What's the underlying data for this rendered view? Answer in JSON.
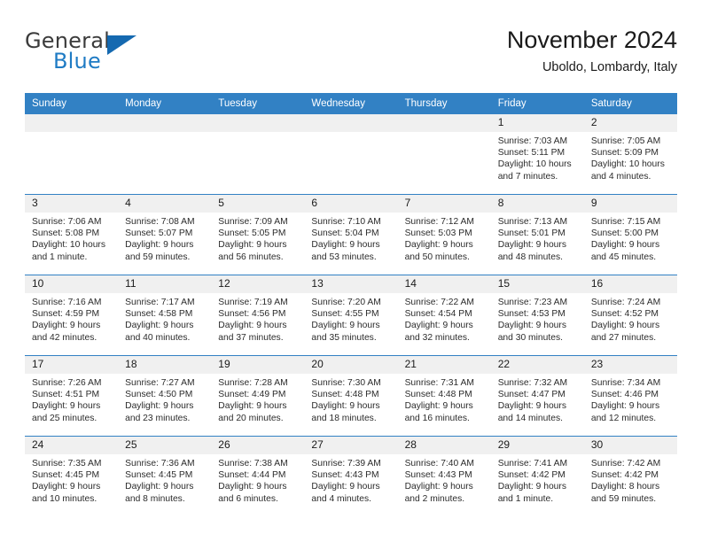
{
  "brand": {
    "word_top": "General",
    "word_bottom": "Blue",
    "triangle_color": "#1569b0",
    "blue_color": "#1f7bc4"
  },
  "header": {
    "title": "November 2024",
    "location": "Uboldo, Lombardy, Italy"
  },
  "theme": {
    "header_blue": "#3281c4",
    "daynum_bg": "#f0f0f0",
    "text": "#2b2b2b"
  },
  "weekdays": [
    "Sunday",
    "Monday",
    "Tuesday",
    "Wednesday",
    "Thursday",
    "Friday",
    "Saturday"
  ],
  "weeks": [
    [
      {
        "day": "",
        "empty": true
      },
      {
        "day": "",
        "empty": true
      },
      {
        "day": "",
        "empty": true
      },
      {
        "day": "",
        "empty": true
      },
      {
        "day": "",
        "empty": true
      },
      {
        "day": "1",
        "sunrise": "Sunrise: 7:03 AM",
        "sunset": "Sunset: 5:11 PM",
        "daylight1": "Daylight: 10 hours",
        "daylight2": "and 7 minutes."
      },
      {
        "day": "2",
        "sunrise": "Sunrise: 7:05 AM",
        "sunset": "Sunset: 5:09 PM",
        "daylight1": "Daylight: 10 hours",
        "daylight2": "and 4 minutes."
      }
    ],
    [
      {
        "day": "3",
        "sunrise": "Sunrise: 7:06 AM",
        "sunset": "Sunset: 5:08 PM",
        "daylight1": "Daylight: 10 hours",
        "daylight2": "and 1 minute."
      },
      {
        "day": "4",
        "sunrise": "Sunrise: 7:08 AM",
        "sunset": "Sunset: 5:07 PM",
        "daylight1": "Daylight: 9 hours",
        "daylight2": "and 59 minutes."
      },
      {
        "day": "5",
        "sunrise": "Sunrise: 7:09 AM",
        "sunset": "Sunset: 5:05 PM",
        "daylight1": "Daylight: 9 hours",
        "daylight2": "and 56 minutes."
      },
      {
        "day": "6",
        "sunrise": "Sunrise: 7:10 AM",
        "sunset": "Sunset: 5:04 PM",
        "daylight1": "Daylight: 9 hours",
        "daylight2": "and 53 minutes."
      },
      {
        "day": "7",
        "sunrise": "Sunrise: 7:12 AM",
        "sunset": "Sunset: 5:03 PM",
        "daylight1": "Daylight: 9 hours",
        "daylight2": "and 50 minutes."
      },
      {
        "day": "8",
        "sunrise": "Sunrise: 7:13 AM",
        "sunset": "Sunset: 5:01 PM",
        "daylight1": "Daylight: 9 hours",
        "daylight2": "and 48 minutes."
      },
      {
        "day": "9",
        "sunrise": "Sunrise: 7:15 AM",
        "sunset": "Sunset: 5:00 PM",
        "daylight1": "Daylight: 9 hours",
        "daylight2": "and 45 minutes."
      }
    ],
    [
      {
        "day": "10",
        "sunrise": "Sunrise: 7:16 AM",
        "sunset": "Sunset: 4:59 PM",
        "daylight1": "Daylight: 9 hours",
        "daylight2": "and 42 minutes."
      },
      {
        "day": "11",
        "sunrise": "Sunrise: 7:17 AM",
        "sunset": "Sunset: 4:58 PM",
        "daylight1": "Daylight: 9 hours",
        "daylight2": "and 40 minutes."
      },
      {
        "day": "12",
        "sunrise": "Sunrise: 7:19 AM",
        "sunset": "Sunset: 4:56 PM",
        "daylight1": "Daylight: 9 hours",
        "daylight2": "and 37 minutes."
      },
      {
        "day": "13",
        "sunrise": "Sunrise: 7:20 AM",
        "sunset": "Sunset: 4:55 PM",
        "daylight1": "Daylight: 9 hours",
        "daylight2": "and 35 minutes."
      },
      {
        "day": "14",
        "sunrise": "Sunrise: 7:22 AM",
        "sunset": "Sunset: 4:54 PM",
        "daylight1": "Daylight: 9 hours",
        "daylight2": "and 32 minutes."
      },
      {
        "day": "15",
        "sunrise": "Sunrise: 7:23 AM",
        "sunset": "Sunset: 4:53 PM",
        "daylight1": "Daylight: 9 hours",
        "daylight2": "and 30 minutes."
      },
      {
        "day": "16",
        "sunrise": "Sunrise: 7:24 AM",
        "sunset": "Sunset: 4:52 PM",
        "daylight1": "Daylight: 9 hours",
        "daylight2": "and 27 minutes."
      }
    ],
    [
      {
        "day": "17",
        "sunrise": "Sunrise: 7:26 AM",
        "sunset": "Sunset: 4:51 PM",
        "daylight1": "Daylight: 9 hours",
        "daylight2": "and 25 minutes."
      },
      {
        "day": "18",
        "sunrise": "Sunrise: 7:27 AM",
        "sunset": "Sunset: 4:50 PM",
        "daylight1": "Daylight: 9 hours",
        "daylight2": "and 23 minutes."
      },
      {
        "day": "19",
        "sunrise": "Sunrise: 7:28 AM",
        "sunset": "Sunset: 4:49 PM",
        "daylight1": "Daylight: 9 hours",
        "daylight2": "and 20 minutes."
      },
      {
        "day": "20",
        "sunrise": "Sunrise: 7:30 AM",
        "sunset": "Sunset: 4:48 PM",
        "daylight1": "Daylight: 9 hours",
        "daylight2": "and 18 minutes."
      },
      {
        "day": "21",
        "sunrise": "Sunrise: 7:31 AM",
        "sunset": "Sunset: 4:48 PM",
        "daylight1": "Daylight: 9 hours",
        "daylight2": "and 16 minutes."
      },
      {
        "day": "22",
        "sunrise": "Sunrise: 7:32 AM",
        "sunset": "Sunset: 4:47 PM",
        "daylight1": "Daylight: 9 hours",
        "daylight2": "and 14 minutes."
      },
      {
        "day": "23",
        "sunrise": "Sunrise: 7:34 AM",
        "sunset": "Sunset: 4:46 PM",
        "daylight1": "Daylight: 9 hours",
        "daylight2": "and 12 minutes."
      }
    ],
    [
      {
        "day": "24",
        "sunrise": "Sunrise: 7:35 AM",
        "sunset": "Sunset: 4:45 PM",
        "daylight1": "Daylight: 9 hours",
        "daylight2": "and 10 minutes."
      },
      {
        "day": "25",
        "sunrise": "Sunrise: 7:36 AM",
        "sunset": "Sunset: 4:45 PM",
        "daylight1": "Daylight: 9 hours",
        "daylight2": "and 8 minutes."
      },
      {
        "day": "26",
        "sunrise": "Sunrise: 7:38 AM",
        "sunset": "Sunset: 4:44 PM",
        "daylight1": "Daylight: 9 hours",
        "daylight2": "and 6 minutes."
      },
      {
        "day": "27",
        "sunrise": "Sunrise: 7:39 AM",
        "sunset": "Sunset: 4:43 PM",
        "daylight1": "Daylight: 9 hours",
        "daylight2": "and 4 minutes."
      },
      {
        "day": "28",
        "sunrise": "Sunrise: 7:40 AM",
        "sunset": "Sunset: 4:43 PM",
        "daylight1": "Daylight: 9 hours",
        "daylight2": "and 2 minutes."
      },
      {
        "day": "29",
        "sunrise": "Sunrise: 7:41 AM",
        "sunset": "Sunset: 4:42 PM",
        "daylight1": "Daylight: 9 hours",
        "daylight2": "and 1 minute."
      },
      {
        "day": "30",
        "sunrise": "Sunrise: 7:42 AM",
        "sunset": "Sunset: 4:42 PM",
        "daylight1": "Daylight: 8 hours",
        "daylight2": "and 59 minutes."
      }
    ]
  ]
}
